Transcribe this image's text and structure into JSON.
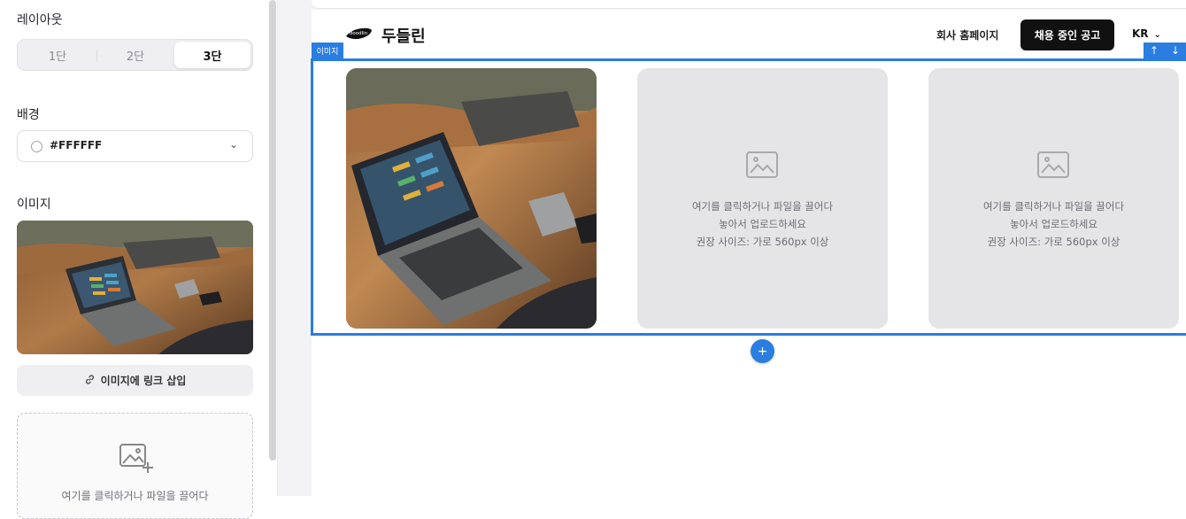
{
  "panel": {
    "layout": {
      "title": "레이아웃",
      "options": [
        "1단",
        "2단",
        "3단"
      ],
      "selected": "3단"
    },
    "background": {
      "title": "배경",
      "value": "#FFFFFF",
      "chevron": "⌄"
    },
    "image": {
      "title": "이미지",
      "link_button": "이미지에 링크 삽입",
      "link_icon": "link-icon",
      "dropzone_text": "여기를 클릭하거나 파일을 끌어다"
    }
  },
  "header": {
    "logo_badge": "doodlin",
    "brand": "두들린",
    "home_link": "회사 홈페이지",
    "jobs_button": "채용 중인 공고",
    "lang": "KR",
    "lang_chevron": "⌄"
  },
  "block": {
    "tag": "이미지",
    "move_up": "↑",
    "move_down": "↓",
    "placeholders": [
      {
        "line1": "여기를 클릭하거나 파일을 끌어다",
        "line2": "놓아서 업로드하세요",
        "line3": "권장 사이즈: 가로 560px 이상"
      },
      {
        "line1": "여기를 클릭하거나 파일을 끌어다",
        "line2": "놓아서 업로드하세요",
        "line3": "권장 사이즈: 가로 560px 이상"
      }
    ],
    "add_label": "+"
  },
  "colors": {
    "accent": "#2a7de1",
    "jobs_button_bg": "#111111",
    "placeholder_bg": "#e5e5e8"
  }
}
